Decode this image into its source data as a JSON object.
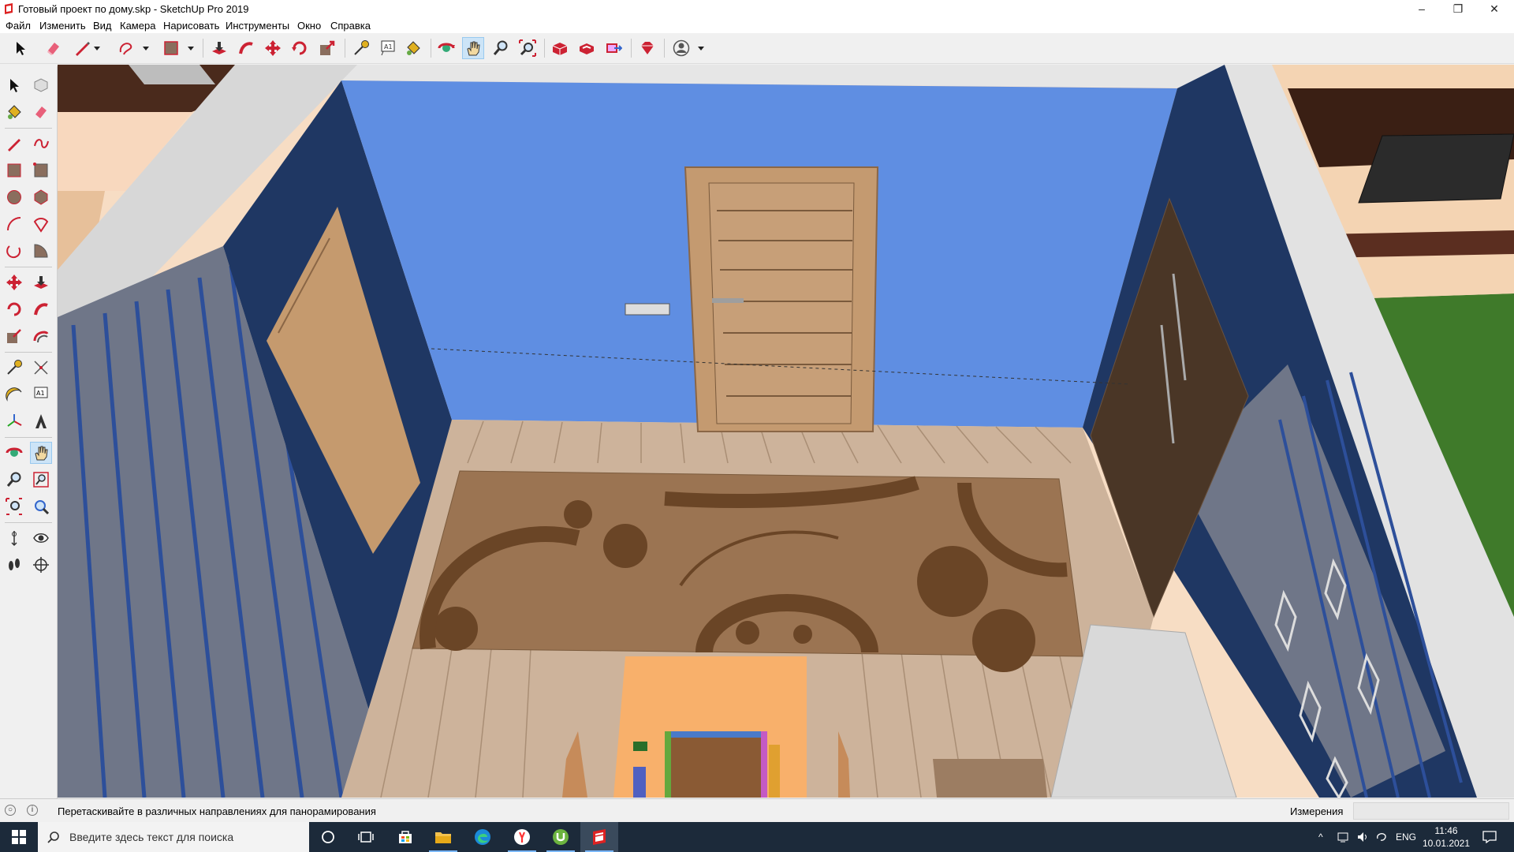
{
  "window": {
    "title": "Готовый проект по дому.skp - SketchUp Pro 2019",
    "controls": {
      "minimize": "–",
      "maximize": "❐",
      "close": "✕"
    }
  },
  "menu": [
    "Файл",
    "Изменить",
    "Вид",
    "Камера",
    "Нарисовать",
    "Инструменты",
    "Окно",
    "Справка"
  ],
  "toolbar": {
    "tools": [
      "select-arrow-icon",
      "eraser-icon",
      "pencil-line-icon",
      "dropdown-icon",
      "freehand-shape-icon",
      "dropdown-icon",
      "rectangle-icon",
      "dropdown-icon",
      "push-pull-icon",
      "follow-me-icon",
      "move-icon",
      "rotate-icon",
      "scale-icon",
      "tape-measure-icon",
      "text-icon",
      "paint-bucket-icon",
      "orbit-icon",
      "pan-hand-icon",
      "zoom-icon",
      "zoom-extents-icon",
      "3d-warehouse-icon",
      "extension-warehouse-icon",
      "send-to-layout-icon",
      "extension-manager-icon",
      "account-icon",
      "dropdown-icon"
    ],
    "active_tool": "pan-hand-icon"
  },
  "left_toolbar": {
    "tools": [
      "select-icon",
      "component-icon",
      "paint-bucket-icon",
      "eraser-icon",
      "pencil-icon",
      "freehand-icon",
      "rectangle-icon",
      "rotated-rectangle-icon",
      "circle-icon",
      "polygon-icon",
      "arc-icon",
      "two-point-arc-icon",
      "three-point-arc-icon",
      "pie-icon",
      "move-icon",
      "push-pull-icon",
      "rotate-icon",
      "follow-me-icon",
      "scale-icon",
      "offset-icon",
      "tape-measure-icon",
      "dimension-icon",
      "protractor-icon",
      "text-icon",
      "axes-icon",
      "3d-text-icon",
      "orbit-icon",
      "pan-icon",
      "zoom-icon",
      "zoom-window-icon",
      "zoom-extents-icon",
      "previous-view-icon",
      "position-camera-icon",
      "look-around-icon",
      "walk-icon",
      "section-plane-icon"
    ],
    "active_tool": "pan-icon"
  },
  "statusbar": {
    "hint": "Перетаскивайте в различных направлениях для панорамирования",
    "measurements_label": "Измерения",
    "measurements_value": ""
  },
  "taskbar": {
    "search_placeholder": "Введите здесь текст для поиска",
    "apps": [
      "cortana-icon",
      "task-view-icon",
      "store-icon",
      "file-explorer-icon",
      "edge-icon",
      "yandex-browser-icon",
      "utorrent-icon",
      "sketchup-icon"
    ],
    "language": "ENG",
    "time": "11:46",
    "date": "10.01.2021"
  },
  "colors": {
    "back_wall": "#5f8ee2",
    "side_wall": "#1f3763",
    "floor": "#cdb39b",
    "rug": "#9b7452",
    "rug_pattern": "#6a4526",
    "door": "#c49a70",
    "wardrobe": "#4a3626",
    "grass": "#3f7a2a",
    "taskbar": "#1c2a3a"
  }
}
